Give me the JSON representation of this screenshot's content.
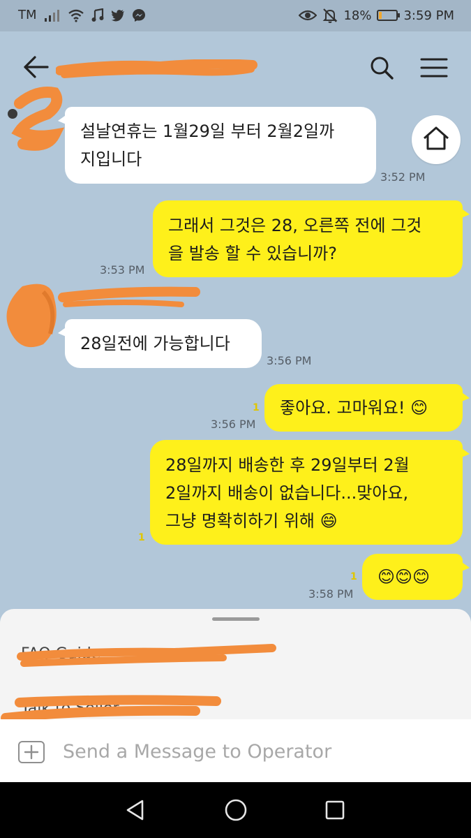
{
  "status_bar": {
    "carrier": "TM",
    "battery_percent": "18%",
    "battery_level": 0.18,
    "time": "3:59 PM",
    "left_icons": [
      "signal-icon",
      "wifi-icon",
      "music-icon",
      "twitter-icon",
      "messenger-icon"
    ],
    "right_icons": [
      "eye-icon",
      "bell-off-icon",
      "battery-icon"
    ]
  },
  "header": {
    "chat_title": "",
    "icons": [
      "back-arrow-icon",
      "search-icon",
      "menu-icon"
    ]
  },
  "colors": {
    "background": "#b2c7d9",
    "incoming_bubble": "#ffffff",
    "outgoing_bubble": "#fef01b",
    "redaction": "#f28c3c",
    "unread_count": "#e0c600"
  },
  "messages": [
    {
      "direction": "in",
      "text": "설날연휴는 1월29일 부터 2월2일까\n지입니다",
      "time": "3:52 PM"
    },
    {
      "direction": "out",
      "text": "그래서 그것은 28, 오른쪽 전에 그것\n을 발송 할 수 있습니까?",
      "time": "3:53 PM"
    },
    {
      "direction": "in",
      "text": "28일전에 가능합니다",
      "time": "3:56 PM"
    },
    {
      "direction": "out",
      "text": "좋아요. 고마워요! 😊",
      "time": "3:56 PM",
      "unread": "1"
    },
    {
      "direction": "out",
      "text": "28일까지 배송한 후 29일부터 2월\n2일까지 배송이 없습니다...맞아요,\n그냥 명확히하기 위해 😄",
      "time": "",
      "unread": "1"
    },
    {
      "direction": "out",
      "text": "😊😊😊",
      "time": "3:58 PM",
      "unread": "1"
    }
  ],
  "bottom_sheet": {
    "items": [
      "FAQ Guide",
      "Talk to Seller"
    ]
  },
  "composer": {
    "placeholder": "Send a Message to Operator"
  },
  "nav_bar": {
    "buttons": [
      "back-triangle-icon",
      "home-circle-icon",
      "recents-square-icon"
    ]
  }
}
